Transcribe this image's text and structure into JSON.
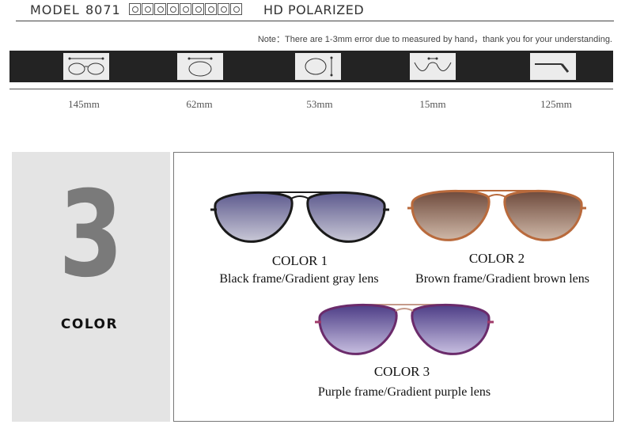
{
  "header": {
    "model_label": "MODEL",
    "model_number": "8071",
    "feature_label": "HD POLARIZED",
    "feature_icons": [
      "lens-icon-1",
      "lens-icon-2",
      "lens-icon-3",
      "lens-icon-4",
      "lens-icon-5",
      "lens-icon-6",
      "lens-icon-7",
      "lens-icon-8",
      "lens-icon-9"
    ]
  },
  "note": "Note：There are 1-3mm error due to measured by hand，thank you for your understanding.",
  "specs": [
    {
      "icon": "frame-width-icon",
      "value": "145mm"
    },
    {
      "icon": "lens-width-icon",
      "value": "62mm"
    },
    {
      "icon": "lens-height-icon",
      "value": "53mm"
    },
    {
      "icon": "bridge-width-icon",
      "value": "15mm"
    },
    {
      "icon": "temple-length-icon",
      "value": "125mm"
    }
  ],
  "color_count": {
    "number": "3",
    "word": "COLOR"
  },
  "colors": [
    {
      "name": "COLOR 1",
      "description": "Black frame/Gradient gray lens",
      "frame_color": "#1a1a1a",
      "lens_top": "#5d5a8e",
      "lens_bottom": "#c9c8d6"
    },
    {
      "name": "COLOR 2",
      "description": "Brown frame/Gradient brown lens",
      "frame_color": "#b96a3c",
      "lens_top": "#6e4a3c",
      "lens_bottom": "#cfb8a8"
    },
    {
      "name": "COLOR 3",
      "description": "Purple frame/Gradient purple lens",
      "frame_color": "#6b2b6b",
      "lens_top": "#4d3d86",
      "lens_bottom": "#c7bfe0"
    }
  ]
}
